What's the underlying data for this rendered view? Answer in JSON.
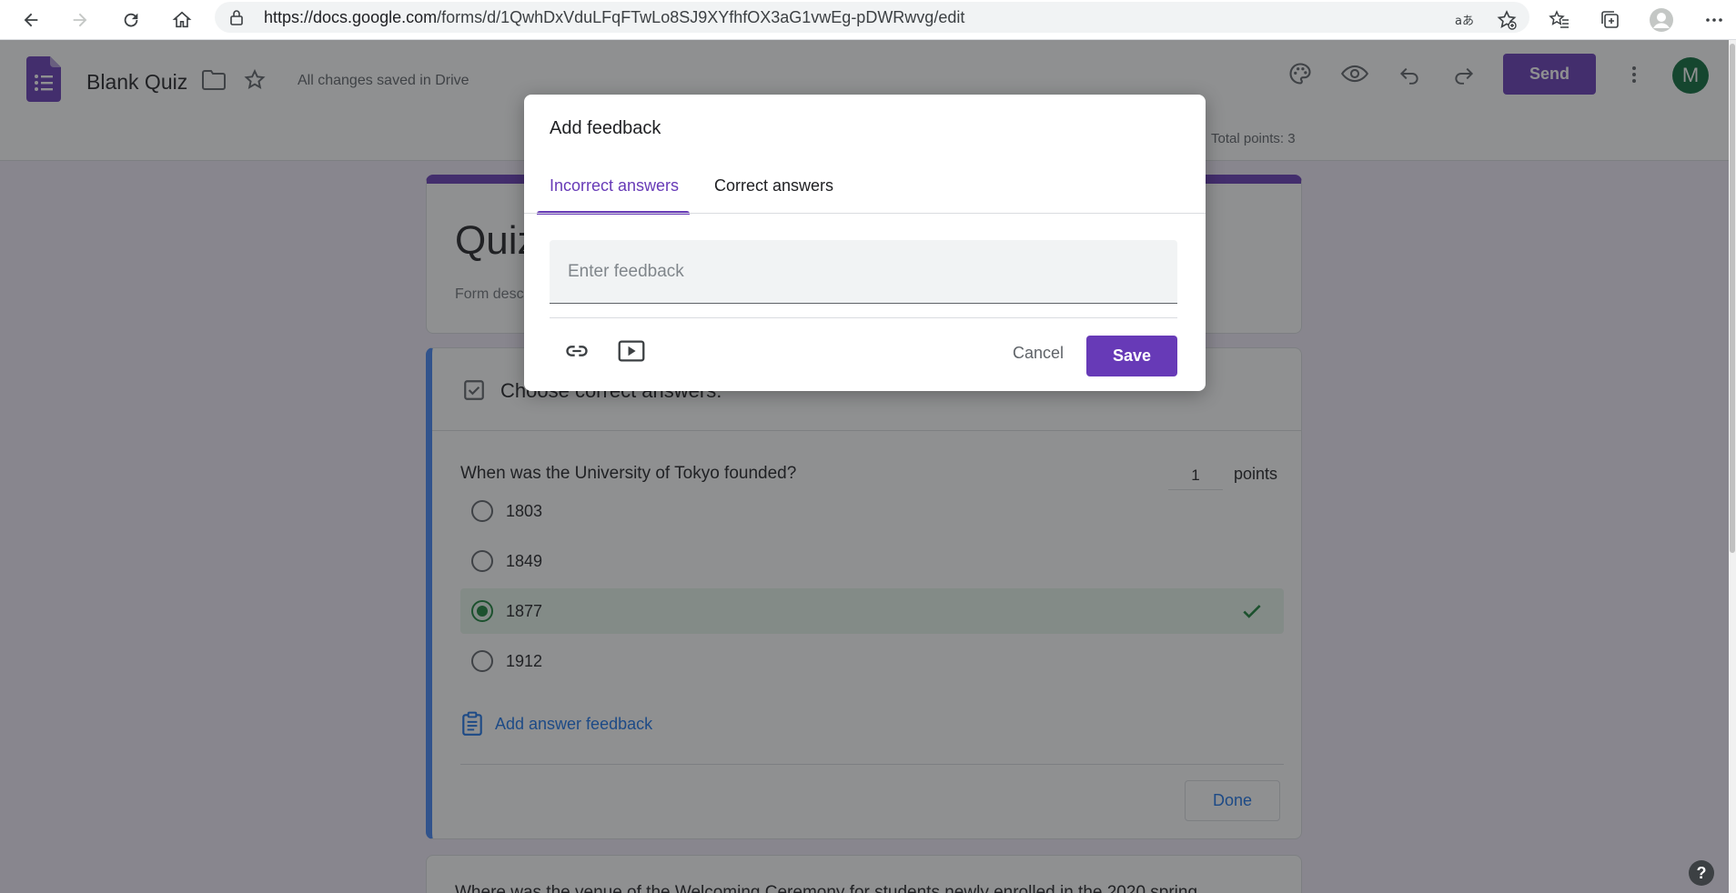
{
  "browser": {
    "url_host": "https://docs.google.com",
    "url_path": "/forms/d/1QwhDxVduLFqFTwLo8SJ9XYfhfOX3aG1vwEg-pDWRwvg/edit"
  },
  "header": {
    "doc_title": "Blank Quiz",
    "saved_status": "All changes saved in Drive",
    "send_label": "Send",
    "avatar_letter": "M",
    "total_points": "Total points: 3",
    "accent_color": "#673ab7"
  },
  "form": {
    "title": "Quiz",
    "description": "Form description",
    "question_header": "Choose correct answers:",
    "question_text": "When was the University of Tokyo founded?",
    "points_value": "1",
    "points_label": "points",
    "options": [
      {
        "label": "1803",
        "correct": false
      },
      {
        "label": "1849",
        "correct": false
      },
      {
        "label": "1877",
        "correct": true
      },
      {
        "label": "1912",
        "correct": false
      }
    ],
    "add_feedback_label": "Add answer feedback",
    "done_label": "Done",
    "next_question_text": "Where was the venue of the Welcoming Ceremony for students newly enrolled in the 2020 spring"
  },
  "dialog": {
    "title": "Add feedback",
    "tabs": [
      {
        "label": "Incorrect answers",
        "active": true
      },
      {
        "label": "Correct answers",
        "active": false
      }
    ],
    "feedback_placeholder": "Enter feedback",
    "cancel_label": "Cancel",
    "save_label": "Save",
    "icons": [
      "link-icon",
      "video-icon"
    ]
  }
}
